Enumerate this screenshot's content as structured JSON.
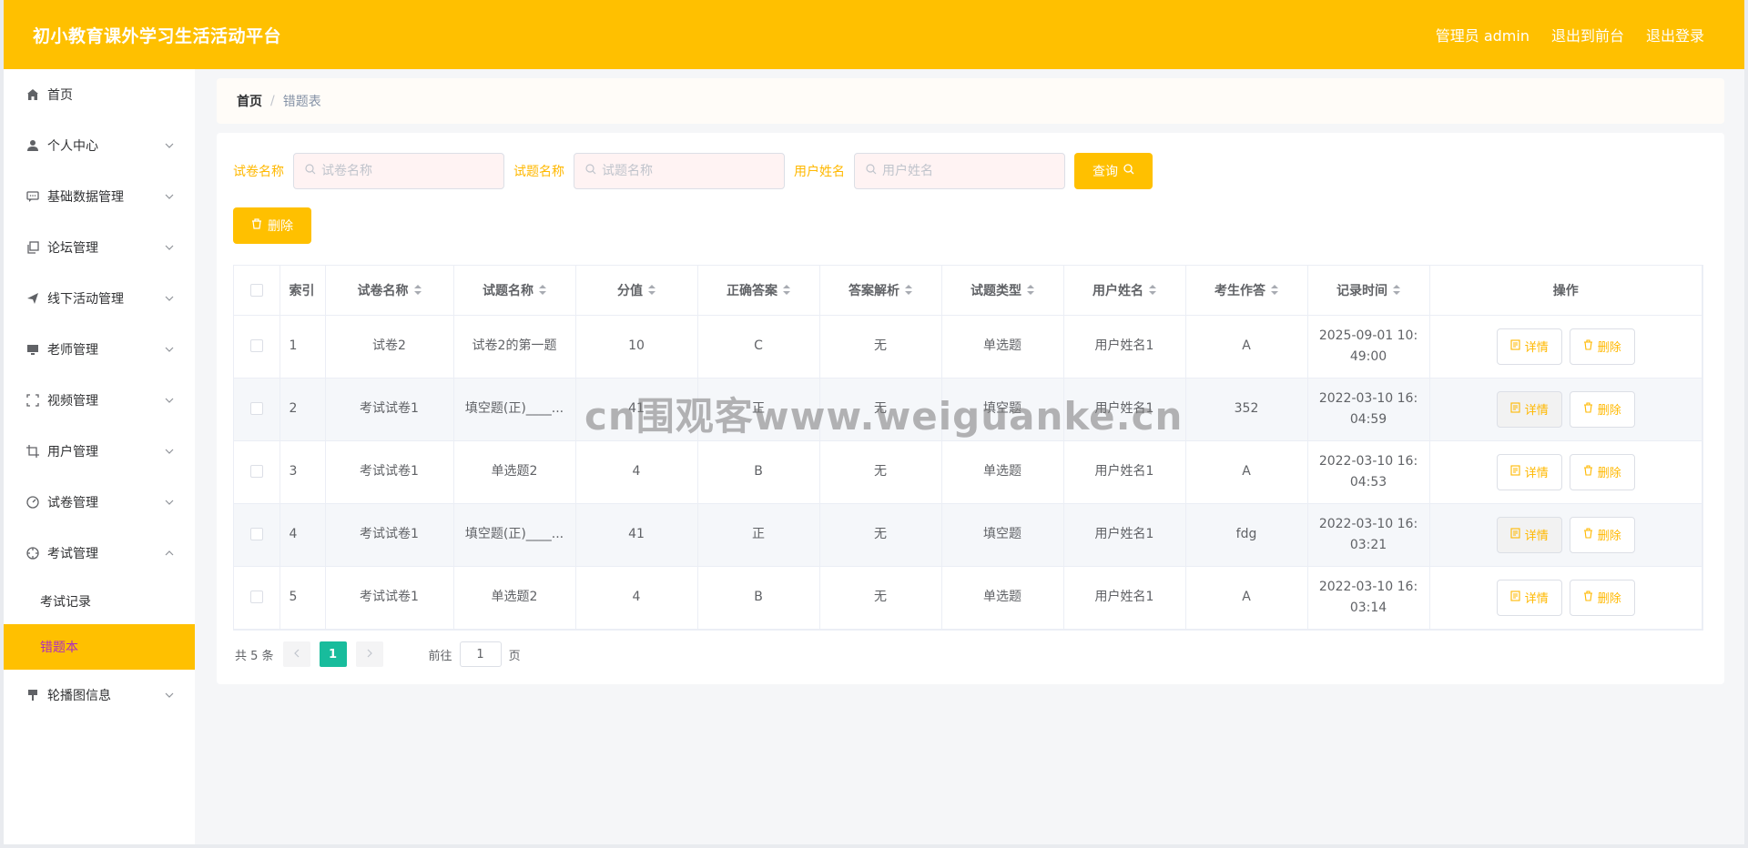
{
  "header": {
    "title": "初小教育课外学习生活活动平台",
    "admin_label": "管理员 admin",
    "back_front": "退出到前台",
    "logout": "退出登录"
  },
  "sidebar": {
    "items": [
      {
        "label": "首页",
        "icon": "home-icon"
      },
      {
        "label": "个人中心",
        "icon": "user-icon"
      },
      {
        "label": "基础数据管理",
        "icon": "chat-icon"
      },
      {
        "label": "论坛管理",
        "icon": "copy-icon"
      },
      {
        "label": "线下活动管理",
        "icon": "send-icon"
      },
      {
        "label": "老师管理",
        "icon": "monitor-icon"
      },
      {
        "label": "视频管理",
        "icon": "fullscreen-icon"
      },
      {
        "label": "用户管理",
        "icon": "crop-icon"
      },
      {
        "label": "试卷管理",
        "icon": "odometer-icon"
      },
      {
        "label": "考试管理",
        "icon": "aim-icon"
      }
    ],
    "sub_items": [
      "考试记录",
      "错题本"
    ],
    "last_item": {
      "label": "轮播图信息",
      "icon": "brush-icon"
    }
  },
  "breadcrumb": {
    "home": "首页",
    "separator": "/",
    "current": "错题表"
  },
  "search": {
    "paper_label": "试卷名称",
    "paper_placeholder": "试卷名称",
    "question_label": "试题名称",
    "question_placeholder": "试题名称",
    "user_label": "用户姓名",
    "user_placeholder": "用户姓名",
    "query_button": "查询"
  },
  "actions": {
    "delete_button": "删除"
  },
  "table": {
    "headers": [
      "索引",
      "试卷名称",
      "试题名称",
      "分值",
      "正确答案",
      "答案解析",
      "试题类型",
      "用户姓名",
      "考生作答",
      "记录时间",
      "操作"
    ],
    "rows": [
      [
        "1",
        "试卷2",
        "试卷2的第一题",
        "10",
        "C",
        "无",
        "单选题",
        "用户姓名1",
        "A",
        "2025-09-01 10:49:00"
      ],
      [
        "2",
        "考试试卷1",
        "填空题(正)____...",
        "41",
        "正",
        "无",
        "填空题",
        "用户姓名1",
        "352",
        "2022-03-10 16:04:59"
      ],
      [
        "3",
        "考试试卷1",
        "单选题2",
        "4",
        "B",
        "无",
        "单选题",
        "用户姓名1",
        "A",
        "2022-03-10 16:04:53"
      ],
      [
        "4",
        "考试试卷1",
        "填空题(正)____...",
        "41",
        "正",
        "无",
        "填空题",
        "用户姓名1",
        "fdg",
        "2022-03-10 16:03:21"
      ],
      [
        "5",
        "考试试卷1",
        "单选题2",
        "4",
        "B",
        "无",
        "单选题",
        "用户姓名1",
        "A",
        "2022-03-10 16:03:14"
      ]
    ],
    "detail_button": "详情",
    "delete_button": "删除"
  },
  "pagination": {
    "total": "共 5 条",
    "current_page": "1",
    "goto_prefix": "前往",
    "goto_value": "1",
    "goto_suffix": "页"
  },
  "watermark": "cn围观客www.weiguanke.cn",
  "colors": {
    "accent": "#ffc000",
    "pagination_active": "#18bc9c",
    "active_sub_text": "#ad2cbf"
  }
}
